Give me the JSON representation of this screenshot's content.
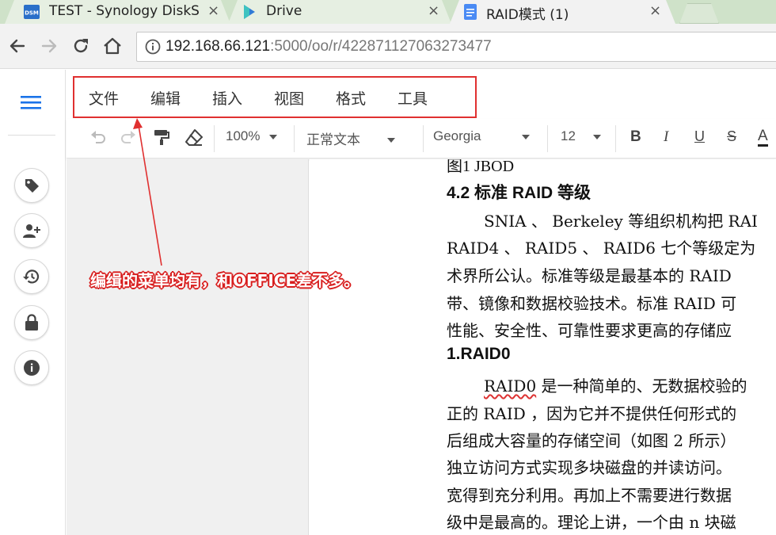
{
  "browser": {
    "tabs": [
      {
        "title": "TEST - Synology DiskSt",
        "icon": "dsm-icon",
        "close": "×"
      },
      {
        "title": "Drive",
        "icon": "synology-drive-icon",
        "close": "×"
      },
      {
        "title": "RAID模式 (1)",
        "icon": "document-icon",
        "close": "×"
      }
    ],
    "dsm_favicon_text": "DSM",
    "url_host": "192.168.66.121",
    "url_rest": ":5000/oo/r/422871127063273477"
  },
  "menu": [
    "文件",
    "编辑",
    "插入",
    "视图",
    "格式",
    "工具"
  ],
  "format_bar": {
    "zoom": "100%",
    "style": "正常文本",
    "font": "Georgia",
    "size": "12",
    "bold": "B",
    "italic": "I",
    "underline": "U",
    "strike": "S",
    "text_color": "A"
  },
  "document": {
    "lines": [
      "图1 JBOD",
      "4.2 标准 RAID 等级",
      "SNIA 、 Berkeley 等组织机构把 RAI",
      "RAID4 、 RAID5 、 RAID6 七个等级定为",
      "术界所公认。标准等级是最基本的 RAID",
      "带、镜像和数据校验技术。标准 RAID 可",
      "性能、安全性、可靠性要求更高的存储应",
      "1.RAID0",
      "RAID0",
      " 是一种简单的、无数据校验的",
      "正的 RAID ，因为它并不提供任何形式的",
      "后组成大容量的存储空间（如图 2 所示）",
      "独立访问方式实现多块磁盘的并读访问。",
      "宽得到充分利用。再加上不需要进行数据",
      "级中是最高的。理论上讲，一个由 n 块磁"
    ]
  },
  "annotation": "编缉的菜单均有，和OFFICE差不多。",
  "colors": {
    "accent": "#1a73e8",
    "annotation": "#e03030"
  }
}
